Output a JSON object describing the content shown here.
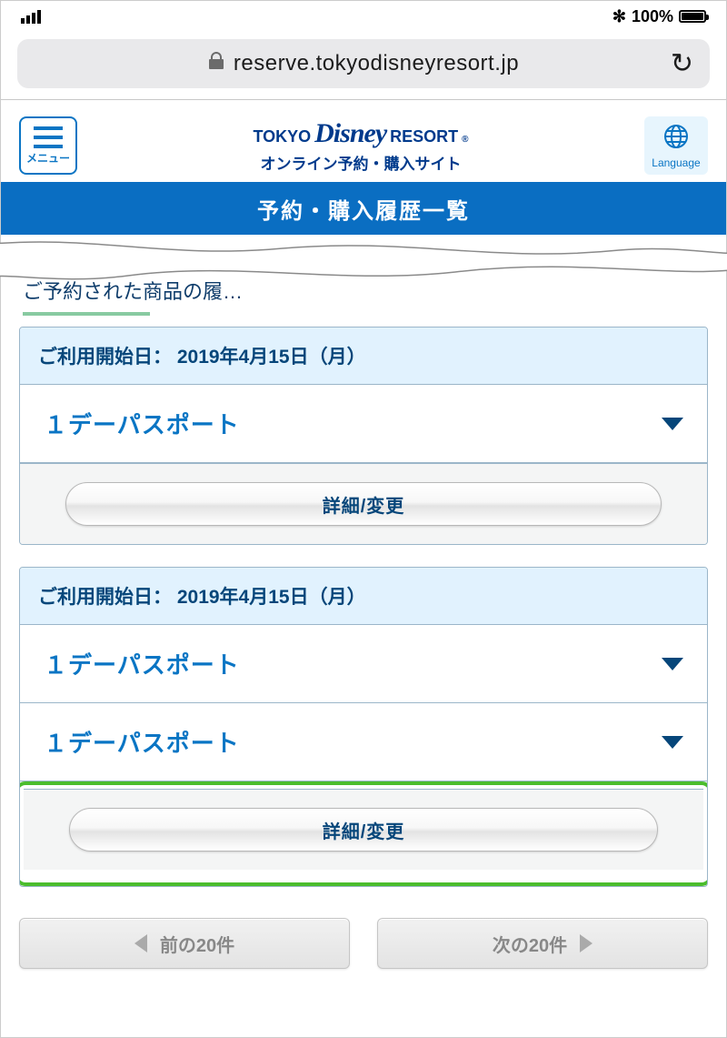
{
  "status": {
    "battery_pct": "100%",
    "bluetooth_glyph": "✻"
  },
  "browser": {
    "url": "reserve.tokyodisneyresort.jp"
  },
  "header": {
    "menu_label": "メニュー",
    "logo_l1_a": "TOKYO",
    "logo_l1_b": "Disney",
    "logo_l1_c": "RESORT",
    "logo_reg": "®",
    "logo_l2": "オンライン予約・購入サイト",
    "lang_label": "Language"
  },
  "title_strip": "予約・購入履歴一覧",
  "partial_text": "ご予約された商品の履…",
  "cards": [
    {
      "date_label": "ご利用開始日：",
      "date_value": "2019年4月15日（月）",
      "rows": [
        {
          "name": "１デーパスポート"
        }
      ],
      "button_label": "詳細/変更"
    },
    {
      "date_label": "ご利用開始日：",
      "date_value": "2019年4月15日（月）",
      "rows": [
        {
          "name": "１デーパスポート"
        },
        {
          "name": "１デーパスポート"
        }
      ],
      "button_label": "詳細/変更"
    }
  ],
  "pager": {
    "prev": "前の20件",
    "next": "次の20件"
  }
}
